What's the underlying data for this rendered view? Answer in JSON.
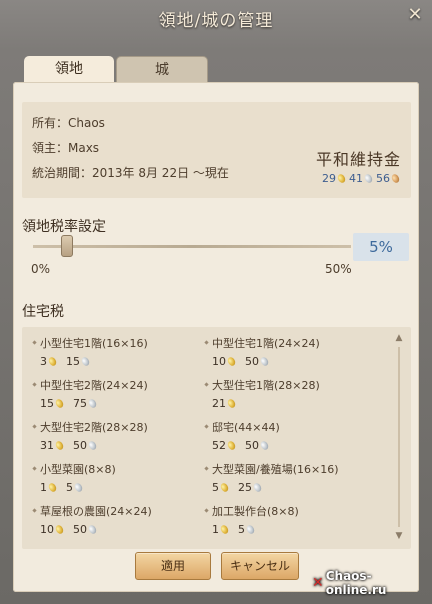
{
  "window": {
    "title": "領地/城の管理",
    "close_label": "✕"
  },
  "tabs": [
    {
      "label": "領地",
      "active": true
    },
    {
      "label": "城",
      "active": false
    }
  ],
  "info": {
    "owner": "所有：Chaos",
    "lord": "領主：Maxs",
    "period": "統治期間：2013年 8月 22日 ～現在",
    "fund_label": "平和維持金",
    "fund": {
      "gold": "29",
      "silver": "41",
      "copper": "56"
    }
  },
  "tax_rate": {
    "title": "領地税率設定",
    "min_label": "0%",
    "max_label": "50%",
    "value_label": "5%",
    "value": 5,
    "min": 0,
    "max": 50
  },
  "housing_tax": {
    "title": "住宅税",
    "items": [
      {
        "name": "小型住宅1階(16×16)",
        "gold": "3",
        "silver": "15"
      },
      {
        "name": "中型住宅1階(24×24)",
        "gold": "10",
        "silver": "50"
      },
      {
        "name": "中型住宅2階(24×24)",
        "gold": "15",
        "silver": "75"
      },
      {
        "name": "大型住宅1階(28×28)",
        "gold": "21",
        "silver": ""
      },
      {
        "name": "大型住宅2階(28×28)",
        "gold": "31",
        "silver": "50"
      },
      {
        "name": "邸宅(44×44)",
        "gold": "52",
        "silver": "50"
      },
      {
        "name": "小型菜園(8×8)",
        "gold": "1",
        "silver": "5"
      },
      {
        "name": "大型菜園/養殖場(16×16)",
        "gold": "5",
        "silver": "25"
      },
      {
        "name": "草屋根の農園(24×24)",
        "gold": "10",
        "silver": "50"
      },
      {
        "name": "加工製作台(8×8)",
        "gold": "1",
        "silver": "5"
      }
    ]
  },
  "buttons": {
    "apply": "適用",
    "cancel": "キャンセル"
  },
  "watermark": {
    "x": "✕",
    "text": "Chaos-online.ru"
  },
  "colors": {
    "panel": "#f2ebde",
    "accent_blue": "#3e6a9c",
    "button": "#dca767"
  }
}
